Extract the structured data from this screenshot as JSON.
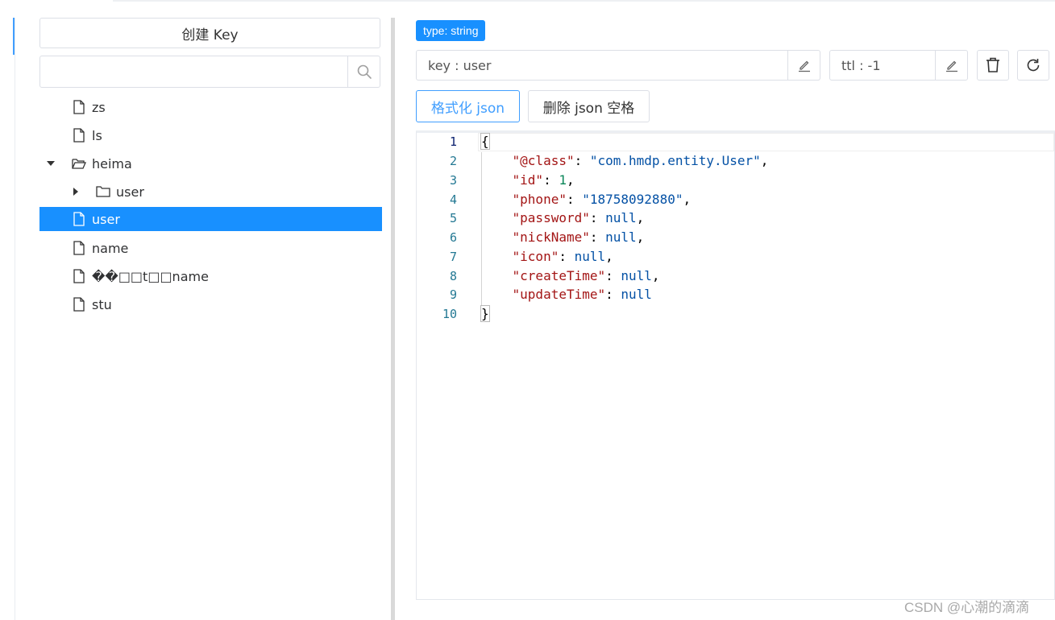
{
  "sidebar": {
    "create_label": "创建 Key",
    "search_placeholder": "",
    "tree": [
      {
        "label": "zs",
        "type": "file",
        "level": 1
      },
      {
        "label": "ls",
        "type": "file",
        "level": 1
      },
      {
        "label": "heima",
        "type": "folder-open",
        "level": 0,
        "expanded": true
      },
      {
        "label": "user",
        "type": "folder",
        "level": 1,
        "expanded": false
      },
      {
        "label": "user",
        "type": "file",
        "level": 1,
        "selected": true
      },
      {
        "label": "name",
        "type": "file",
        "level": 1
      },
      {
        "label": "��□□t□□name",
        "type": "file",
        "level": 1
      },
      {
        "label": "stu",
        "type": "file",
        "level": 1
      }
    ]
  },
  "detail": {
    "type_tag": "type: string",
    "key_field": "key : user",
    "ttl_field": "ttl : -1",
    "format_json_label": "格式化 json",
    "remove_spaces_label": "删除 json 空格"
  },
  "editor": {
    "line_numbers": [
      "1",
      "2",
      "3",
      "4",
      "5",
      "6",
      "7",
      "8",
      "9",
      "10"
    ],
    "active_line": 1,
    "lines": [
      "{",
      "    \"@class\": \"com.hmdp.entity.User\",",
      "    \"id\": 1,",
      "    \"phone\": \"18758092880\",",
      "    \"password\": null,",
      "    \"nickName\": null,",
      "    \"icon\": null,",
      "    \"createTime\": null,",
      "    \"updateTime\": null",
      "}"
    ]
  },
  "watermark": "CSDN @心潮的滴滴",
  "colors": {
    "accent": "#1890ff",
    "primary_border": "#409eff",
    "key_color": "#a31515",
    "string_color": "#0451a5",
    "number_color": "#098658"
  }
}
